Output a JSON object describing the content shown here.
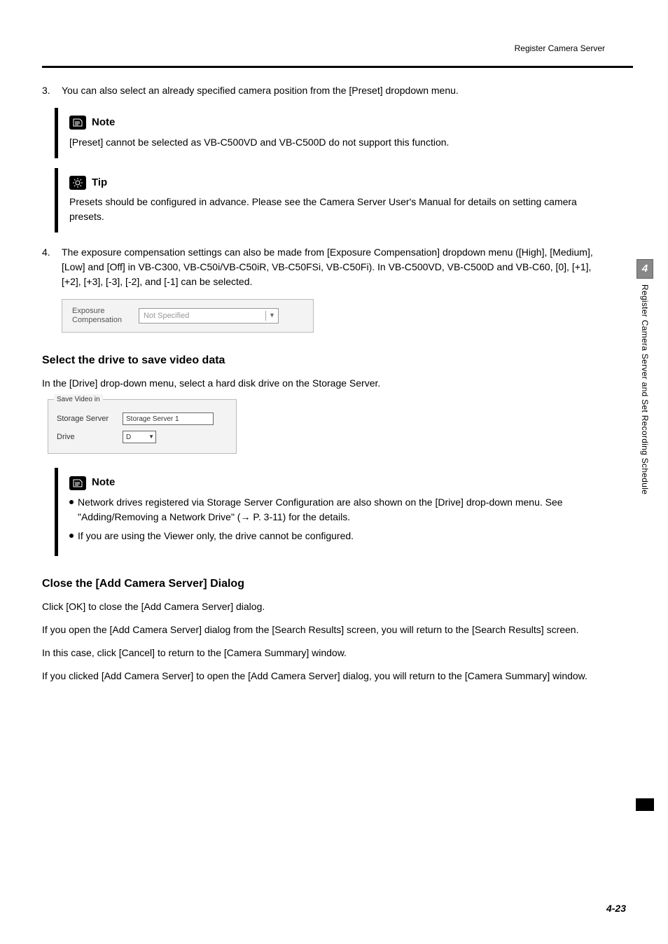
{
  "header": {
    "title": "Register Camera Server"
  },
  "sidebar": {
    "chapter_num": "4",
    "chapter_title": "Register Camera Server and Set Recording Schedule"
  },
  "step3": {
    "num": "3.",
    "text": "You can also select an already specified camera position from the [Preset] dropdown menu."
  },
  "note1": {
    "title": "Note",
    "body": "[Preset] cannot be selected as VB-C500VD and VB-C500D do not support this function."
  },
  "tip1": {
    "title": "Tip",
    "body": "Presets should be configured in advance. Please see the Camera Server User's Manual for details on setting camera presets."
  },
  "step4": {
    "num": "4.",
    "text": "The exposure compensation settings can also be made from [Exposure Compensation] dropdown menu ([High], [Medium], [Low] and [Off] in VB-C300, VB-C50i/VB-C50iR, VB-C50FSi, VB-C50Fi). In VB-C500VD, VB-C500D and VB-C60, [0], [+1], [+2], [+3], [-3], [-2], and [-1] can be selected."
  },
  "exp_fig": {
    "label_line1": "Exposure",
    "label_line2": "Compensation",
    "value": "Not Specified"
  },
  "sec_drive": {
    "heading": "Select the drive to save video data",
    "intro": "In the [Drive] drop-down menu, select a hard disk drive on the Storage Server."
  },
  "save_fig": {
    "legend": "Save Video in",
    "row1_label": "Storage Server",
    "row1_value": "Storage Server 1",
    "row2_label": "Drive",
    "row2_value": "D"
  },
  "note2": {
    "title": "Note",
    "b1": "Network drives registered via Storage Server Configuration are also shown on the [Drive] drop-down menu. See \"Adding/Removing a Network Drive\" (→ P. 3-11) for the details.",
    "b2": "If you are using the Viewer only, the drive cannot be configured."
  },
  "sec_close": {
    "heading": "Close the [Add Camera Server] Dialog",
    "p1": "Click [OK] to close the [Add Camera Server] dialog.",
    "p2": "If you open the [Add Camera Server] dialog from the [Search Results] screen, you will return to the [Search Results] screen.",
    "p3": "In this case, click [Cancel] to return to the [Camera Summary] window.",
    "p4": "If you clicked [Add Camera Server] to open the [Add Camera Server] dialog, you will return to the [Camera Summary] window."
  },
  "footer": {
    "page": "4-23"
  }
}
